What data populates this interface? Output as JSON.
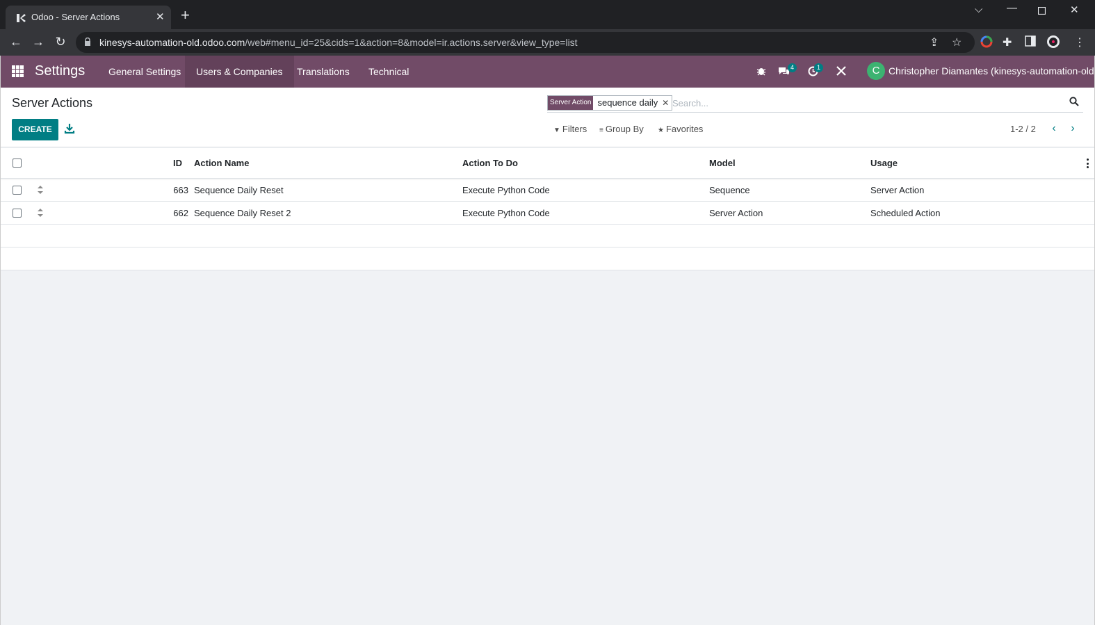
{
  "browser": {
    "tab_title": "Odoo - Server Actions",
    "url_host": "kinesys-automation-old.odoo.com",
    "url_path": "/web#menu_id=25&cids=1&action=8&model=ir.actions.server&view_type=list"
  },
  "navbar": {
    "brand": "Settings",
    "menu": [
      "General Settings",
      "Users & Companies",
      "Translations",
      "Technical"
    ],
    "messages_badge": "4",
    "activities_badge": "1",
    "avatar_letter": "C",
    "user_name": "Christopher Diamantes (kinesys-automation-old)"
  },
  "control_panel": {
    "breadcrumb": "Server Actions",
    "create_label": "CREATE",
    "facet_label": "Server Action",
    "facet_value": "sequence daily",
    "search_placeholder": "Search...",
    "filters_label": "Filters",
    "group_by_label": "Group By",
    "favorites_label": "Favorites",
    "pager_value": "1-2 / 2"
  },
  "list": {
    "columns": [
      "ID",
      "Action Name",
      "Action To Do",
      "Model",
      "Usage"
    ],
    "rows": [
      {
        "id": "663",
        "name": "Sequence Daily Reset",
        "action": "Execute Python Code",
        "model": "Sequence",
        "usage": "Server Action"
      },
      {
        "id": "662",
        "name": "Sequence Daily Reset 2",
        "action": "Execute Python Code",
        "model": "Server Action",
        "usage": "Scheduled Action"
      }
    ]
  }
}
